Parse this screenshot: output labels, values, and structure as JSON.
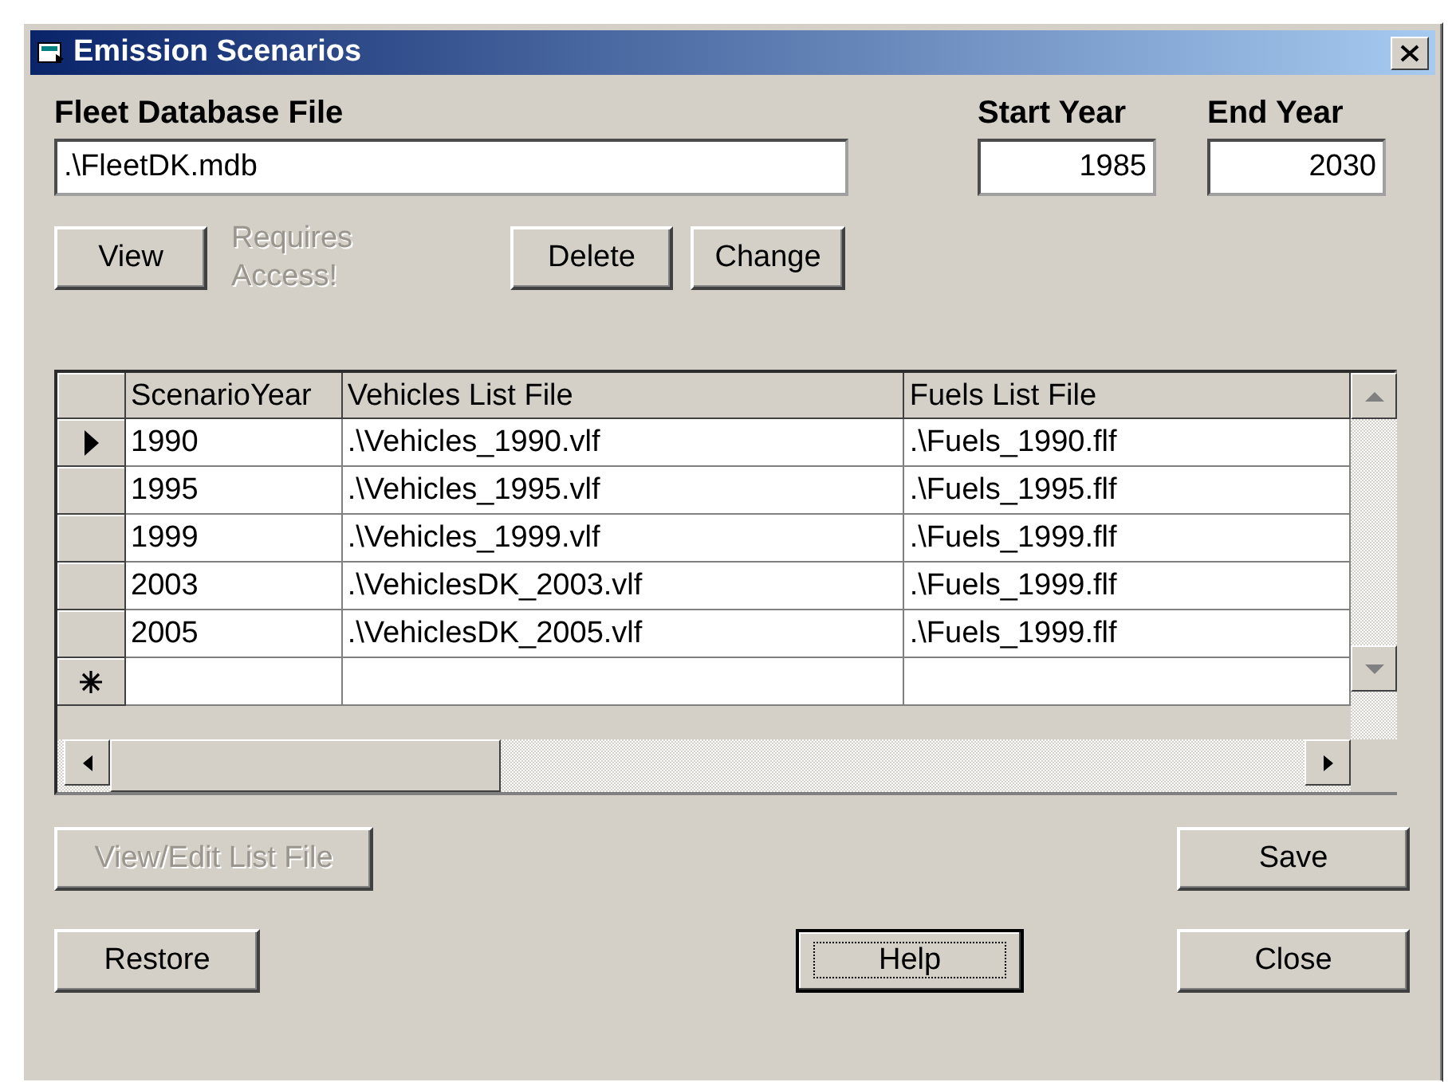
{
  "window": {
    "title": "Emission Scenarios"
  },
  "fleet_database": {
    "label": "Fleet Database File",
    "value": ".\\FleetDK.mdb"
  },
  "start_year": {
    "label": "Start Year",
    "value": "1985"
  },
  "end_year": {
    "label": "End Year",
    "value": "2030"
  },
  "top_buttons": [
    {
      "label": "View",
      "disabled": false
    },
    {
      "label": "Delete",
      "disabled": false
    },
    {
      "label": "Change",
      "disabled": false
    }
  ],
  "note": "Requires Access!",
  "table": {
    "columns": [
      "ScenarioYear",
      "Vehicles List File",
      "Fuels List File"
    ],
    "rows": [
      {
        "kind": "data",
        "selected": true,
        "cells": [
          "1990",
          ".\\Vehicles_1990.vlf",
          ".\\Fuels_1990.flf"
        ]
      },
      {
        "kind": "data",
        "selected": false,
        "cells": [
          "1995",
          ".\\Vehicles_1995.vlf",
          ".\\Fuels_1995.flf"
        ]
      },
      {
        "kind": "data",
        "selected": false,
        "cells": [
          "1999",
          ".\\Vehicles_1999.vlf",
          ".\\Fuels_1999.flf"
        ]
      },
      {
        "kind": "data",
        "selected": false,
        "cells": [
          "2003",
          ".\\VehiclesDK_2003.vlf",
          ".\\Fuels_1999.flf"
        ]
      },
      {
        "kind": "data",
        "selected": false,
        "cells": [
          "2005",
          ".\\VehiclesDK_2005.vlf",
          ".\\Fuels_1999.flf"
        ]
      },
      {
        "kind": "new",
        "selected": false,
        "cells": []
      }
    ]
  },
  "bottom_buttons": [
    {
      "label": "View/Edit List File",
      "disabled": true,
      "focused": false
    },
    {
      "label": "Save",
      "disabled": false,
      "focused": false
    },
    {
      "label": "Restore",
      "disabled": false,
      "focused": false
    },
    {
      "label": "Help",
      "disabled": false,
      "focused": true
    },
    {
      "label": "Close",
      "disabled": false,
      "focused": false
    }
  ]
}
